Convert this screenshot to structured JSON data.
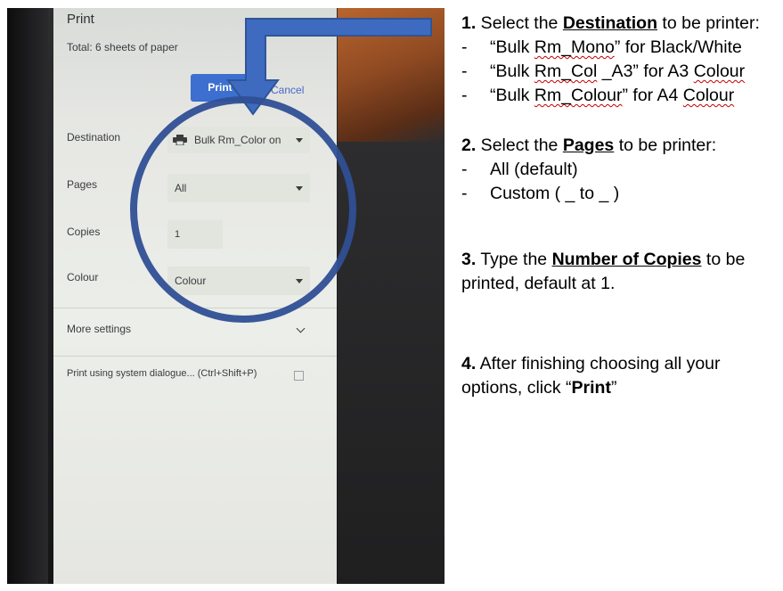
{
  "dialog": {
    "title": "Print",
    "total": "Total: 6 sheets of paper",
    "print_button": "Print",
    "cancel_button": "Cancel",
    "destination_label": "Destination",
    "destination_value": "Bulk Rm_Color on",
    "pages_label": "Pages",
    "pages_value": "All",
    "copies_label": "Copies",
    "copies_value": "1",
    "colour_label": "Colour",
    "colour_value": "Colour",
    "more_settings": "More settings",
    "system_dialog": "Print using system dialogue... (Ctrl+Shift+P)"
  },
  "icons": [
    "printer-icon",
    "dropdown-caret-icon",
    "chevron-down-icon",
    "open-external-icon",
    "arrow-annotation",
    "circle-annotation"
  ],
  "colors": {
    "annotation_blue": "#3b5fa8",
    "print_button": "#3c6fd0",
    "spell_squiggle": "#c00000"
  },
  "instructions": {
    "step1": {
      "num": "1.",
      "pre": " Select the ",
      "key": "Destination",
      "post": " to be printer:",
      "bullets": [
        {
          "dash": "-",
          "q1": "“Bulk ",
          "sq": "Rm_Mono",
          "q2": "” for Black/White"
        },
        {
          "dash": "-",
          "q1": "“Bulk ",
          "sq": "Rm_Col",
          "q2": " _A3” for A3 ",
          "sq2": "Colour"
        },
        {
          "dash": "-",
          "q1": "“Bulk ",
          "sq": "Rm_Colour",
          "q2": "” for A4 ",
          "sq2": "Colour"
        }
      ]
    },
    "step2": {
      "num": "2.",
      "pre": " Select the ",
      "key": "Pages",
      "post": " to be printer:",
      "bullets": [
        {
          "dash": "-",
          "text": "All (default)"
        },
        {
          "dash": "-",
          "text": "Custom ( _ to _ )"
        }
      ]
    },
    "step3": {
      "num": "3.",
      "pre": " Type the ",
      "key": "Number of Copies",
      "post": " to be printed, default at 1."
    },
    "step4": {
      "num": "4.",
      "pre": " After finishing choosing all your options, click “",
      "key": "Print",
      "post": "”"
    }
  }
}
